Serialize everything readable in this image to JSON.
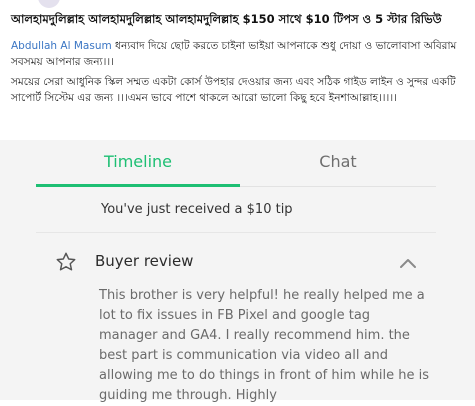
{
  "post": {
    "headline": "আলহামদুলিল্লাহ আলহামদুলিল্লাহ আলহামদুলিল্লাহ $150 সাথে $10 টিপস ও 5 স্টার রিভিউ",
    "reply_author": "Abdullah Al Masum",
    "reply_text": " ধন্যবাদ দিয়ে ছোট করতে চাইনা ভাইয়া আপনাকে শুধু দোয়া ও ভালোবাসা অবিরাম সবসময় আপনার জন্য।।।",
    "paragraph": "সময়ের সেরা আধুনিক স্কিল সম্মত একটা কোর্স উপহার দেওয়ার জন্য এবং সঠিক গাইড লাইন ও সুন্দর একটি সাপোর্ট সিস্টেম এর জন্য ।।।এমন ভাবে পাশে থাকলে আরো ভালো কিছু হবে ইনশাআল্লাহ।।।।।"
  },
  "tabs": {
    "timeline": "Timeline",
    "chat": "Chat",
    "active": "timeline"
  },
  "timeline": {
    "tip_message": "You've just received a $10 tip",
    "review_title": "Buyer review",
    "review_text": "This brother is very helpful! he really helped me a lot to fix issues in FB Pixel and google tag manager and GA4. I really recommend him. the best part is communication via video all and allowing me to do things in front of him while he is guiding me through. Highly"
  },
  "colors": {
    "accent": "#1dbf73",
    "link": "#3b76c4"
  },
  "icons": {
    "star": "star-outline-icon",
    "chevron": "chevron-up-icon"
  }
}
